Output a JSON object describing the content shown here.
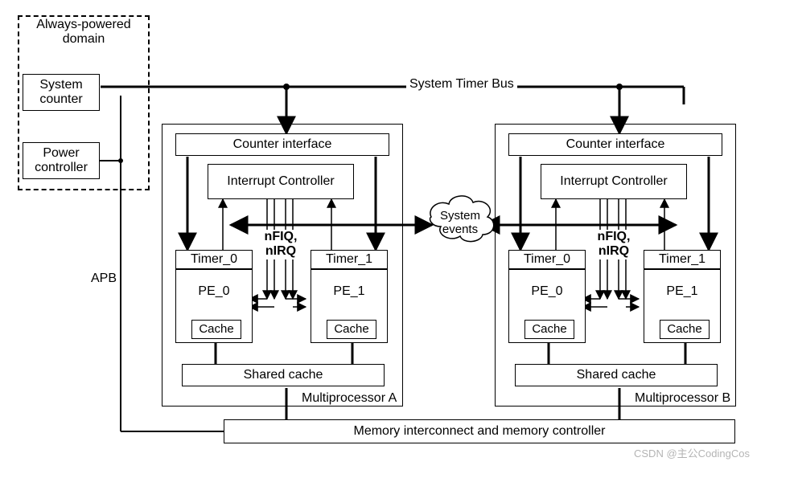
{
  "always_powered_title": "Always-powered\ndomain",
  "system_counter": "System\ncounter",
  "power_controller": "Power\ncontroller",
  "apb": "APB",
  "system_timer_bus": "System Timer Bus",
  "system_events": "System\nevents",
  "memory": "Memory interconnect and memory controller",
  "mp_a": {
    "counter_interface": "Counter interface",
    "interrupt_controller": "Interrupt\nController",
    "nfiq_nirq": "nFIQ,\nnIRQ",
    "timer0": "Timer_0",
    "timer1": "Timer_1",
    "pe0": "PE_0",
    "pe1": "PE_1",
    "cache": "Cache",
    "shared_cache": "Shared cache",
    "label": "Multiprocessor A"
  },
  "mp_b": {
    "counter_interface": "Counter interface",
    "interrupt_controller": "Interrupt\nController",
    "nfiq_nirq": "nFIQ,\nnIRQ",
    "timer0": "Timer_0",
    "timer1": "Timer_1",
    "pe0": "PE_0",
    "pe1": "PE_1",
    "cache": "Cache",
    "shared_cache": "Shared cache",
    "label": "Multiprocessor B"
  },
  "watermark": "CSDN @主公CodingCos"
}
